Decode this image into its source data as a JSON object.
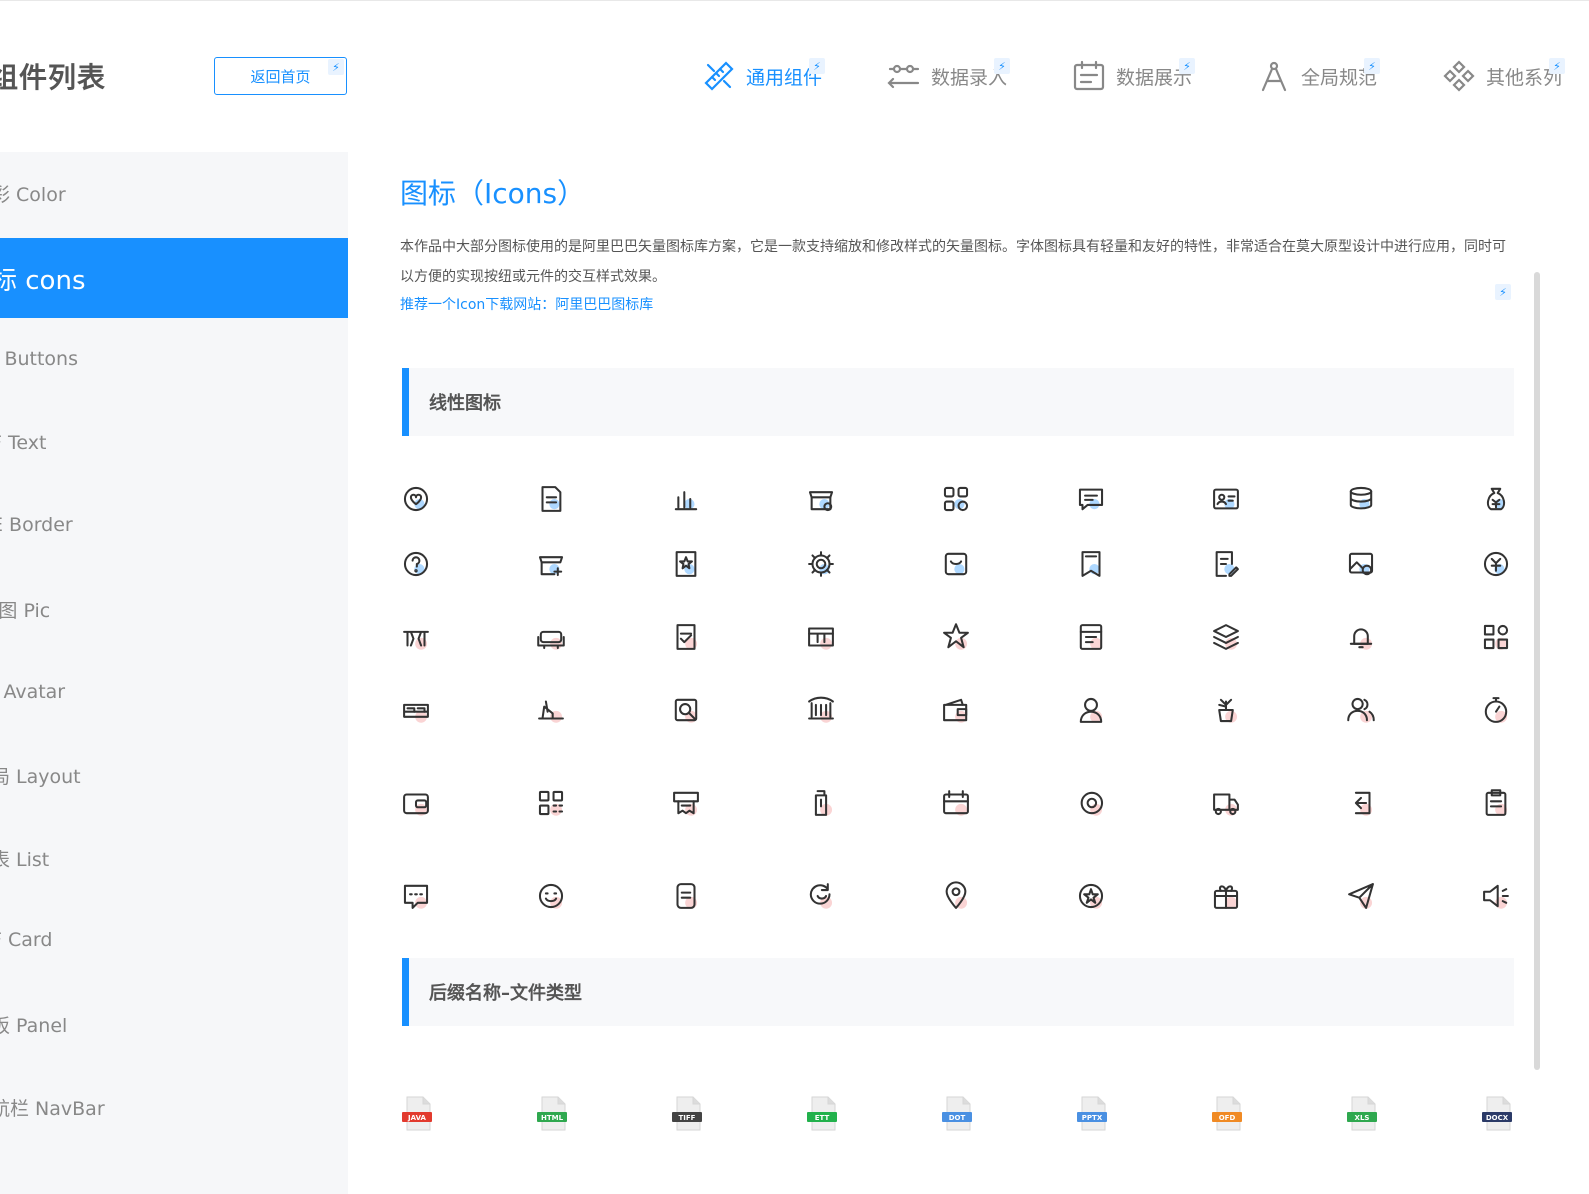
{
  "header": {
    "page_title": "组件列表",
    "home_button": "返回首页",
    "nav": [
      {
        "label": "通用组件",
        "icon": "ruler-pencil-icon",
        "active": true
      },
      {
        "label": "数据录入",
        "icon": "sliders-icon",
        "active": false
      },
      {
        "label": "数据展示",
        "icon": "calendar-list-icon",
        "active": false
      },
      {
        "label": "全局规范",
        "icon": "compass-icon",
        "active": false
      },
      {
        "label": "其他系列",
        "icon": "diamond-grid-icon",
        "active": false
      }
    ]
  },
  "sidebar": {
    "items": [
      {
        "label": "彩 Color",
        "active": false
      },
      {
        "label": "标 cons",
        "active": true
      },
      {
        "label": "] Buttons",
        "active": false
      },
      {
        "label": "F Text",
        "active": false
      },
      {
        "label": "E Border",
        "active": false
      },
      {
        "label": "(图 Pic",
        "active": false
      },
      {
        "label": "\\ Avatar",
        "active": false
      },
      {
        "label": "局 Layout",
        "active": false
      },
      {
        "label": "表 List",
        "active": false
      },
      {
        "label": "F Card",
        "active": false
      },
      {
        "label": "板 Panel",
        "active": false
      },
      {
        "label": "航栏 NavBar",
        "active": false
      }
    ]
  },
  "main": {
    "title": "图标（Icons）",
    "description": "本作品中大部分图标使用的是阿里巴巴矢量图标库方案，它是一款支持缩放和修改样式的矢量图标。字体图标具有轻量和友好的特性，非常适合在莫大原型设计中进行应用，同时可以方便的实现按纽或元件的交互样式效果。",
    "link": "推荐一个Icon下载网站：阿里巴巴图标库",
    "sections": [
      {
        "title": "线性图标"
      },
      {
        "title": "后缀名称–文件类型"
      }
    ],
    "file_types": [
      {
        "ext": "JAVA",
        "color": "#e23a2e"
      },
      {
        "ext": "HTML",
        "color": "#2fa84f"
      },
      {
        "ext": "TIFF",
        "color": "#444444"
      },
      {
        "ext": "ETT",
        "color": "#22b14c"
      },
      {
        "ext": "DOT",
        "color": "#4a90e2"
      },
      {
        "ext": "PPTX",
        "color": "#4a90e2"
      },
      {
        "ext": "OFD",
        "color": "#f08a24"
      },
      {
        "ext": "XLS",
        "color": "#2fa84f"
      },
      {
        "ext": "DOCX",
        "color": "#2b3a67"
      }
    ]
  },
  "icon_rows": [
    [
      "heart-location-icon",
      "document-icon",
      "bar-chart-icon",
      "store-settings-icon",
      "apps-grid-icon",
      "message-icon",
      "id-card-icon",
      "coins-icon",
      "money-bag-icon"
    ],
    [
      "help-circle-icon",
      "store-add-icon",
      "star-document-icon",
      "gear-icon",
      "shopping-bag-icon",
      "bookmark-icon",
      "document-edit-icon",
      "image-settings-icon",
      "yen-circle-icon"
    ],
    [
      "dining-table-icon",
      "sofa-icon",
      "report-icon",
      "toolbox-icon",
      "star-icon",
      "kitchen-icon",
      "layers-icon",
      "bell-icon",
      "grid-icon"
    ],
    [
      "bed-icon",
      "ship-icon",
      "search-document-icon",
      "crib-icon",
      "wallet-icon",
      "user-icon",
      "plant-icon",
      "users-icon",
      "stopwatch-icon"
    ],
    [
      "wallet-card-icon",
      "qr-grid-icon",
      "receipt-icon",
      "bottle-icon",
      "calendar-icon",
      "target-icon",
      "delivery-truck-icon",
      "logout-icon",
      "clipboard-icon"
    ],
    [
      "chat-icon",
      "face-icon",
      "file-note-icon",
      "refresh-face-icon",
      "map-pin-icon",
      "star-circle-icon",
      "gift-icon",
      "send-icon",
      "speaker-icon"
    ]
  ],
  "colors": {
    "primary": "#1890ff",
    "icon_dark": "#333333",
    "accent_pink": "#f5a0a0",
    "accent_blue": "#1890ff",
    "sidebar_bg": "#f6f7f9",
    "section_bg": "#f7f8fa"
  }
}
